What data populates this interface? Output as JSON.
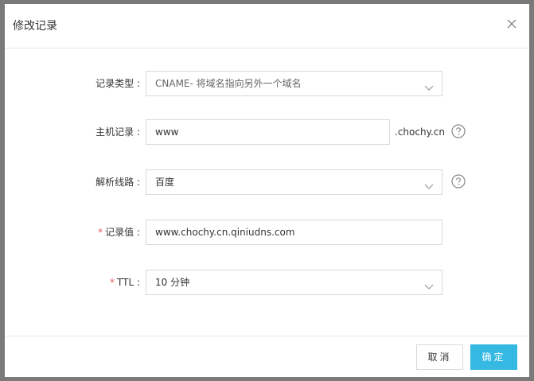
{
  "dialog": {
    "title": "修改记录",
    "close_icon": "close-icon"
  },
  "form": {
    "record_type": {
      "label": "记录类型 :",
      "value": "CNAME- 将域名指向另外一个域名",
      "required": false
    },
    "host_record": {
      "label": "主机记录 :",
      "value": "www",
      "suffix": ".chochy.cn",
      "required": false
    },
    "resolve_line": {
      "label": "解析线路 :",
      "value": "百度",
      "required": false
    },
    "record_value": {
      "label": "记录值 :",
      "value": "www.chochy.cn.qiniudns.com",
      "required": true
    },
    "ttl": {
      "label": "TTL :",
      "value": "10 分钟",
      "required": true
    },
    "required_mark": "*"
  },
  "footer": {
    "cancel_label": "取消",
    "ok_label": "确定"
  },
  "colors": {
    "primary": "#35b9e3",
    "required": "#e85a5a",
    "border": "#d9d9d9"
  }
}
